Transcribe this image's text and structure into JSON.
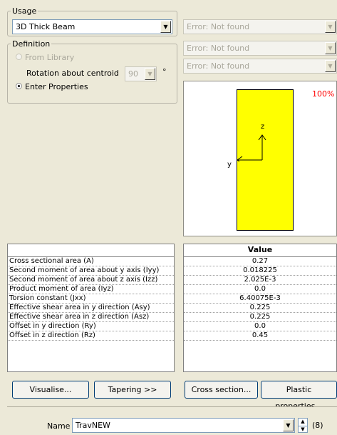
{
  "usage": {
    "legend": "Usage",
    "selected": "3D Thick Beam"
  },
  "definition": {
    "legend": "Definition",
    "from_library": "From Library",
    "rotation_label": "Rotation about centroid",
    "rotation_value": "90",
    "rotation_unit": "°",
    "enter_properties": "Enter Properties"
  },
  "error_combos": [
    "Error: Not found",
    "Error: Not found",
    "Error: Not found"
  ],
  "preview": {
    "zoom": "100%",
    "axis_z": "z",
    "axis_y": "y",
    "section_color": "#ffff00"
  },
  "properties": {
    "header": "Value",
    "rows": [
      {
        "name": "Cross sectional area (A)",
        "value": "0.27"
      },
      {
        "name": "Second moment of area about y axis (Iyy)",
        "value": "0.018225"
      },
      {
        "name": "Second moment of area about z axis (Izz)",
        "value": "2.025E-3"
      },
      {
        "name": "Product moment of area (Iyz)",
        "value": "0.0"
      },
      {
        "name": "Torsion constant (Jxx)",
        "value": "6.40075E-3"
      },
      {
        "name": "Effective shear area in y direction (Asy)",
        "value": "0.225"
      },
      {
        "name": "Effective shear area in z direction (Asz)",
        "value": "0.225"
      },
      {
        "name": "Offset in y direction (Ry)",
        "value": "0.0"
      },
      {
        "name": "Offset in z direction (Rz)",
        "value": "0.45"
      }
    ]
  },
  "buttons": {
    "visualise": "Visualise...",
    "tapering": "Tapering >>",
    "cross_section": "Cross section...",
    "plastic": "Plastic properties..."
  },
  "name": {
    "label": "Name",
    "value": "TravNEW",
    "count": "(8)"
  }
}
